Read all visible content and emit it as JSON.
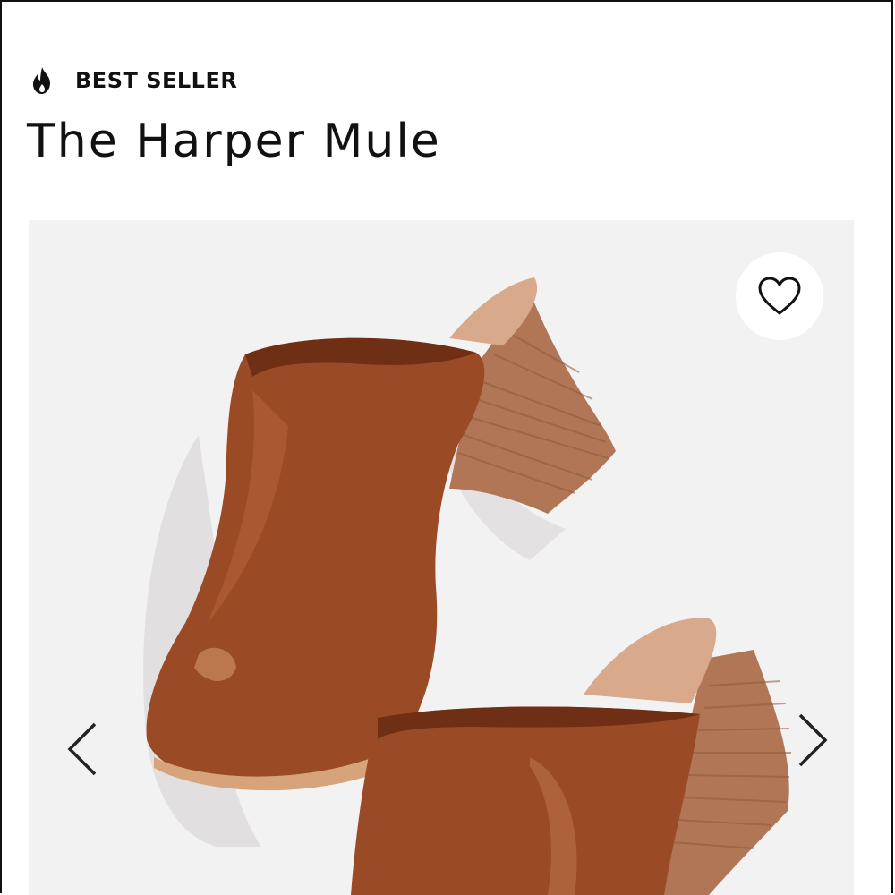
{
  "badge": {
    "icon": "flame-icon",
    "label": "BEST SELLER"
  },
  "product": {
    "title": "The Harper Mule"
  },
  "gallery": {
    "favorite_icon": "heart-icon",
    "prev_icon": "chevron-left-icon",
    "next_icon": "chevron-right-icon",
    "colors": {
      "background": "#f3f2f3",
      "leather": "#9b4a26",
      "leather_dark": "#6e2f14",
      "heel_wood": "#b07656",
      "lining": "#d9a98c"
    }
  }
}
